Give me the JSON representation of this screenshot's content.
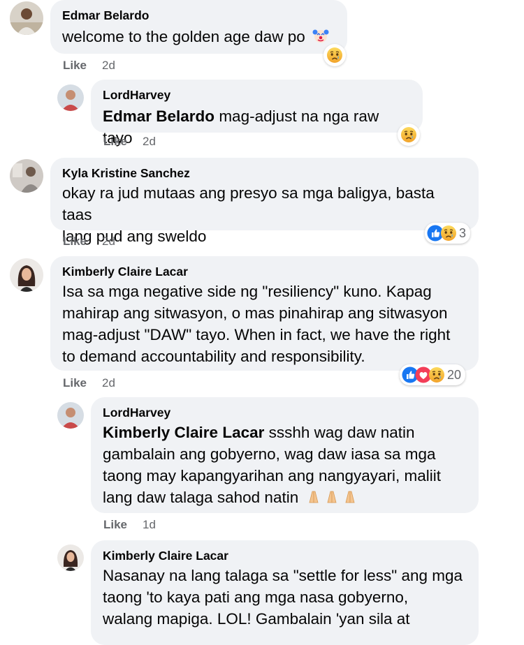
{
  "colors": {
    "bubble": "#f0f2f5",
    "meta_text": "#65676b",
    "like_blue": "#1877f2",
    "love_red": "#f33e58",
    "sad_yellow": "#f7b125"
  },
  "comments": [
    {
      "author": "Edmar Belardo",
      "text": "welcome to the golden age daw po",
      "emoji": "clown-face-icon",
      "like_label": "Like",
      "time": "2d",
      "reactions": [
        "sad"
      ]
    },
    {
      "author": "LordHarvey",
      "mention": "Edmar Belardo",
      "text": " mag-adjust na nga raw tayo",
      "like_label": "Like",
      "time": "2d",
      "reactions": [
        "sad"
      ]
    },
    {
      "author": "Kyla Kristine Sanchez",
      "lines": [
        "okay ra jud mutaas ang presyo sa mga baligya, basta taas",
        "lang pud ang sweldo"
      ],
      "like_label": "Like",
      "time": "2d",
      "reactions": [
        "like",
        "sad"
      ],
      "reaction_count": "3"
    },
    {
      "author": "Kimberly Claire Lacar",
      "lines": [
        "Isa sa mga negative side ng \"resiliency\" kuno. Kapag",
        "mahirap ang sitwasyon, o mas pinahirap ang sitwasyon",
        "mag-adjust \"DAW\" tayo. When in fact, we have the right",
        "to demand accountability and responsibility."
      ],
      "like_label": "Like",
      "time": "2d",
      "reactions": [
        "like",
        "love",
        "sad"
      ],
      "reaction_count": "20"
    },
    {
      "author": "LordHarvey",
      "mention": "Kimberly Claire Lacar",
      "line1": " ssshh wag daw natin",
      "lines": [
        "gambalain ang gobyerno, wag daw iasa sa mga",
        "taong may kapangyarihan ang nangyayari, maliit",
        "lang daw talaga sahod natin"
      ],
      "emoji": "folded-hands-icon",
      "like_label": "Like",
      "time": "1d"
    },
    {
      "author": "Kimberly Claire Lacar",
      "lines": [
        "Nasanay na lang talaga sa \"settle for less\" ang mga",
        "taong 'to kaya pati ang mga nasa gobyerno,",
        "walang mapiga. LOL! Gambalain 'yan sila at"
      ]
    }
  ]
}
